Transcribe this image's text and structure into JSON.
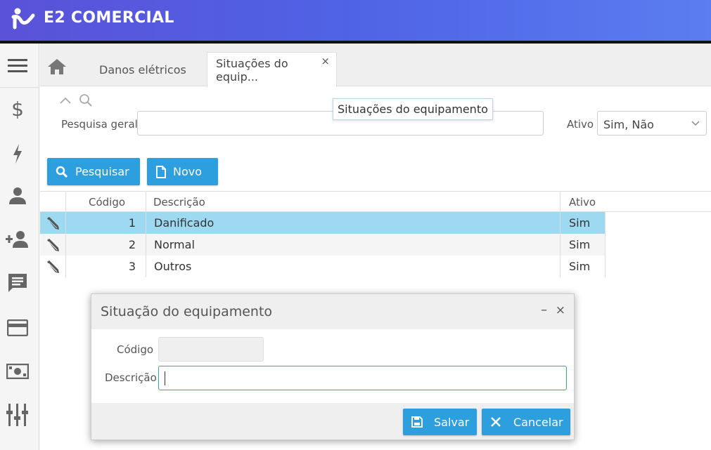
{
  "header": {
    "brand": "E2 COMERCIAL"
  },
  "sidebar": {
    "items": [
      {
        "icon": "menu-icon"
      },
      {
        "icon": "dollar-icon"
      },
      {
        "icon": "lightning-icon"
      },
      {
        "icon": "person-icon"
      },
      {
        "icon": "person-add-icon"
      },
      {
        "icon": "chat-icon"
      },
      {
        "icon": "credit-card-icon"
      },
      {
        "icon": "cash-icon"
      },
      {
        "icon": "equalizer-icon"
      }
    ]
  },
  "tabs": {
    "items": [
      {
        "label": "Danos elétricos"
      },
      {
        "label": "Situações do equip..."
      }
    ],
    "close_glyph": "×",
    "tooltip": "Situações do equipamento"
  },
  "filter": {
    "search_label": "Pesquisa geral",
    "search_value": "",
    "active_label": "Ativo",
    "active_value": "Sim, Não"
  },
  "toolbar": {
    "search_button": "Pesquisar",
    "new_button": "Novo"
  },
  "grid": {
    "columns": [
      "Código",
      "Descrição",
      "Ativo"
    ],
    "rows": [
      {
        "codigo": "1",
        "descricao": "Danificado",
        "ativo": "Sim"
      },
      {
        "codigo": "2",
        "descricao": "Normal",
        "ativo": "Sim"
      },
      {
        "codigo": "3",
        "descricao": "Outros",
        "ativo": "Sim"
      }
    ]
  },
  "dialog": {
    "title": "Situação do equipamento",
    "minimize_glyph": "–",
    "close_glyph": "×",
    "codigo_label": "Código",
    "codigo_value": "",
    "descricao_label": "Descrição",
    "descricao_value": "",
    "save_button": "Salvar",
    "cancel_button": "Cancelar"
  },
  "colors": {
    "accent": "#2d9ede",
    "selected_row": "#9dd9f0",
    "header_gradient_start": "#5a52d8",
    "header_gradient_end": "#5b7df0"
  }
}
